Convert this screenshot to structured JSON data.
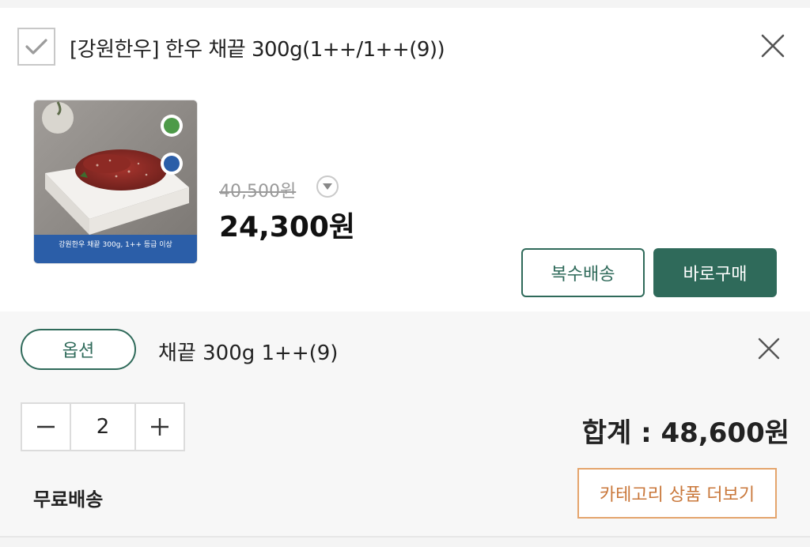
{
  "product": {
    "title": "[강원한우] 한우 채끝 300g(1++/1++(9))",
    "thumbnail_caption": "강원한우 채끝 300g, 1++ 등급 이상",
    "original_price": "40,500원",
    "sale_price": "24,300원",
    "checked": true
  },
  "actions": {
    "multi_delivery_label": "복수배송",
    "buy_now_label": "바로구매"
  },
  "option": {
    "badge_label": "옵션",
    "name": "채끝 300g 1++(9)",
    "quantity": "2",
    "total": "합계 : 48,600원"
  },
  "footer": {
    "shipping_label": "무료배송",
    "category_more_label": "카테고리 상품 더보기"
  },
  "colors": {
    "accent_green": "#2f6a5a",
    "accent_orange": "#e4a46c"
  }
}
